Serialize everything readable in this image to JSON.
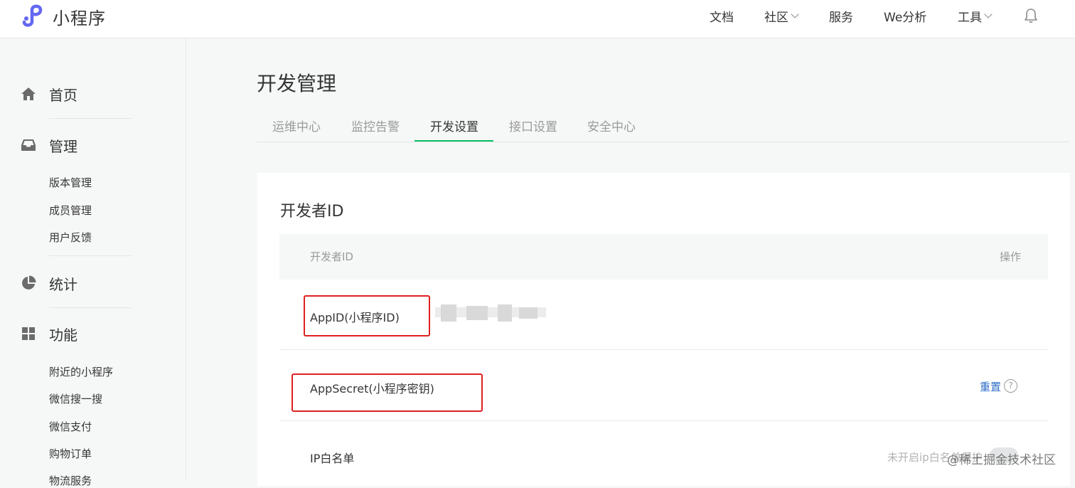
{
  "header": {
    "app_title": "小程序",
    "nav": [
      {
        "label": "文档",
        "has_dropdown": false
      },
      {
        "label": "社区",
        "has_dropdown": true
      },
      {
        "label": "服务",
        "has_dropdown": false
      },
      {
        "label": "We分析",
        "has_dropdown": false
      },
      {
        "label": "工具",
        "has_dropdown": true
      }
    ],
    "bell_icon": "bell-icon"
  },
  "sidebar": {
    "sections": [
      {
        "label": "首页",
        "icon": "home-icon",
        "items": []
      },
      {
        "label": "管理",
        "icon": "inbox-icon",
        "items": [
          "版本管理",
          "成员管理",
          "用户反馈"
        ]
      },
      {
        "label": "统计",
        "icon": "pie-chart-icon",
        "items": []
      },
      {
        "label": "功能",
        "icon": "grid-icon",
        "items": [
          "附近的小程序",
          "微信搜一搜",
          "微信支付",
          "购物订单",
          "物流服务"
        ]
      }
    ]
  },
  "main": {
    "title": "开发管理",
    "tabs": [
      {
        "label": "运维中心",
        "active": false
      },
      {
        "label": "监控告警",
        "active": false
      },
      {
        "label": "开发设置",
        "active": true
      },
      {
        "label": "接口设置",
        "active": false
      },
      {
        "label": "安全中心",
        "active": false
      }
    ],
    "card": {
      "title": "开发者ID",
      "columns": [
        "开发者ID",
        "操作"
      ],
      "rows": [
        {
          "label": "AppID(小程序ID)",
          "value": "",
          "action": ""
        },
        {
          "label": "AppSecret(小程序密钥)",
          "value": "",
          "action": "重置"
        },
        {
          "label": "IP白名单",
          "value": "",
          "action": "未开启ip白名单保护"
        }
      ],
      "help_icon": "question-circle-icon"
    }
  },
  "watermark": "@稀土掘金技术社区",
  "colors": {
    "accent_green": "#07c160",
    "link_blue": "#2e6ec6",
    "highlight_red": "#e02020",
    "logo_purple": "#6467f0"
  }
}
